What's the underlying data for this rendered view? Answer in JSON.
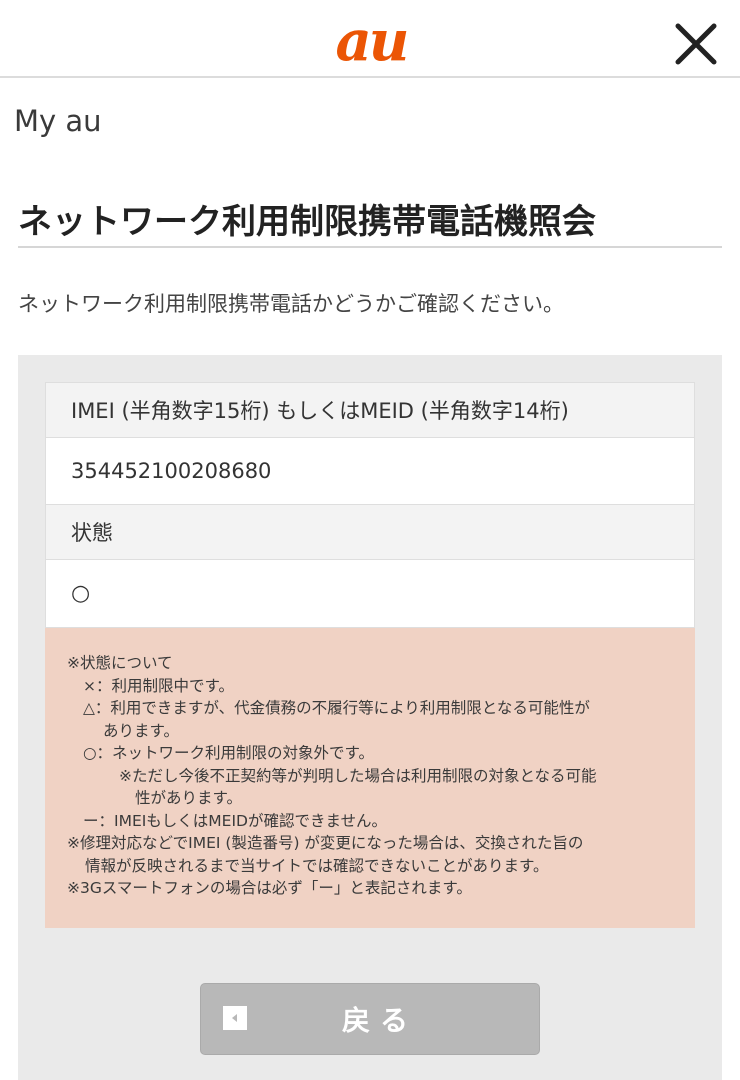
{
  "header": {
    "logo_text": "au",
    "close_icon": "close-x-icon"
  },
  "brand": "My au",
  "page_title": "ネットワーク利用制限携帯電話機照会",
  "lead_text": "ネットワーク利用制限携帯電話かどうかご確認ください。",
  "table": {
    "imei_label": "IMEI (半角数字15桁) もしくはMEID (半角数字14桁)",
    "imei_value": "354452100208680",
    "status_label": "状態",
    "status_value": "○"
  },
  "notes": [
    "※状態について",
    "×：利用制限中です。",
    "△：利用できますが、代金債務の不履行等により利用制限となる可能性が",
    "あります。",
    "○：ネットワーク利用制限の対象外です。",
    "※ただし今後不正契約等が判明した場合は利用制限の対象となる可能",
    "性があります。",
    "ー：IMEIもしくはMEIDが確認できません。",
    "※修理対応などでIMEI (製造番号) が変更になった場合は、交換された旨の",
    "情報が反映されるまで当サイトでは確認できないことがあります。",
    "※3Gスマートフォンの場合は必ず「ー」と表記されます。"
  ],
  "back_button": {
    "label": "戻る",
    "icon": "back-arrow-icon"
  },
  "colors": {
    "brand_orange": "#eb5505",
    "notes_background": "#f0d2c4",
    "panel_background": "#eaeaea",
    "button_gray": "#b8b8b8"
  }
}
